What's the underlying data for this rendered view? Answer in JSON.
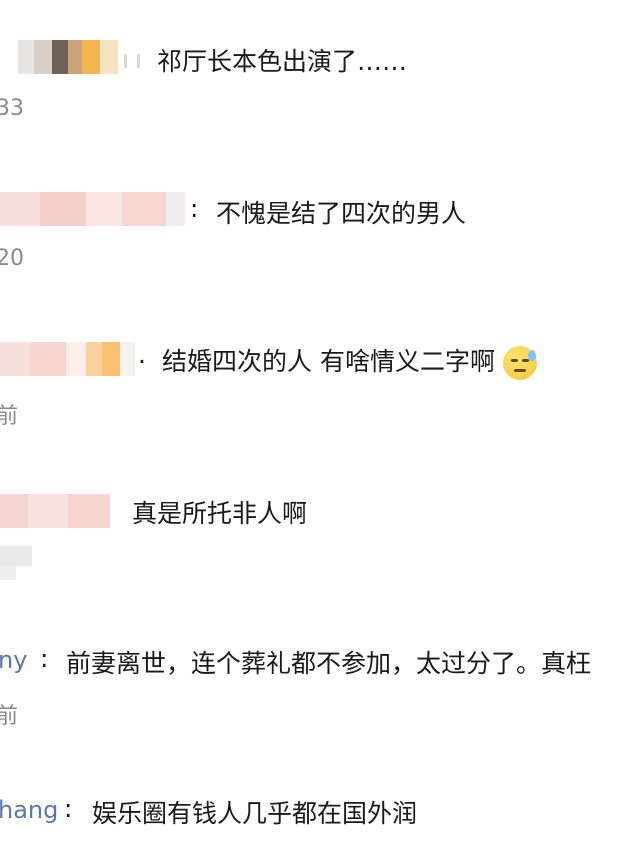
{
  "comments": [
    {
      "text": "祁厅长本色出演了……",
      "meta": "33",
      "sep": ":"
    },
    {
      "text": "不愧是结了四次的男人",
      "meta": "20",
      "sep": ":"
    },
    {
      "text": "结婚四次的人 有啥情义二字啊",
      "meta": "前",
      "sep": "."
    },
    {
      "text": "真是所托非人啊",
      "meta": "",
      "sep": ""
    },
    {
      "user": "ny",
      "sep": ":",
      "text": "前妻离世，连个葬礼都不参加，太过分了。真枉",
      "meta": "前"
    },
    {
      "user": "hang",
      "sep": ":",
      "text": "娱乐圈有钱人几乎都在国外润",
      "meta": ""
    }
  ],
  "icons": {
    "sweat": "sweat-smile-emoji"
  }
}
